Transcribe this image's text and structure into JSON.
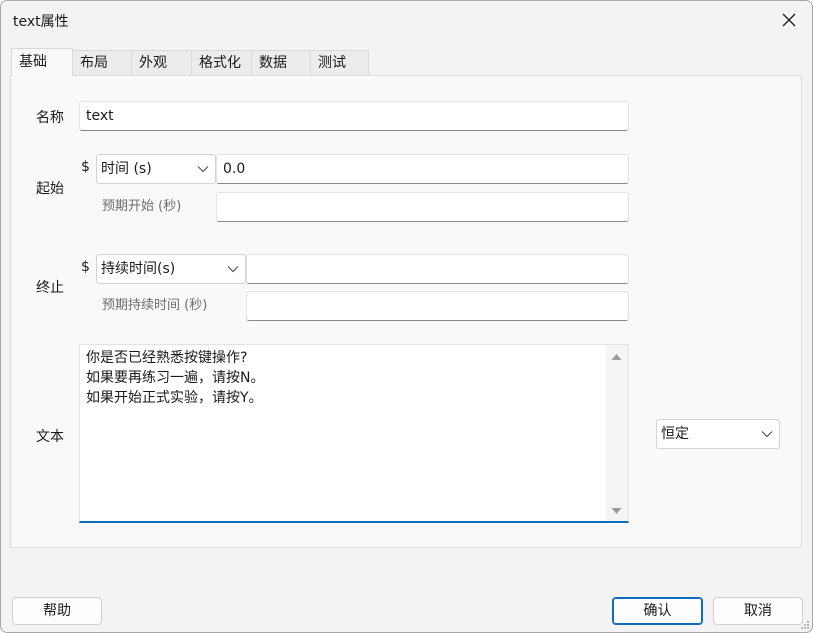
{
  "window": {
    "title": "text属性"
  },
  "tabs": [
    {
      "label": "基础"
    },
    {
      "label": "布局"
    },
    {
      "label": "外观"
    },
    {
      "label": "格式化"
    },
    {
      "label": "数据"
    },
    {
      "label": "测试"
    }
  ],
  "active_tab": "基础",
  "fields": {
    "name": {
      "label": "名称",
      "value": "text"
    },
    "start": {
      "label": "起始",
      "dollar": "$",
      "type_select": "时间 (s)",
      "value": "0.0",
      "expected_label": "预期开始 (秒)",
      "expected_value": ""
    },
    "stop": {
      "label": "终止",
      "dollar": "$",
      "type_select": "持续时间(s)",
      "value": "",
      "expected_label": "预期持续时间 (秒)",
      "expected_value": ""
    },
    "text": {
      "label": "文本",
      "lines": [
        "你是否已经熟悉按键操作?",
        "如果要再练习一遍，请按N。",
        "如果开始正式实验，请按Y。"
      ],
      "update_select": "恒定"
    }
  },
  "buttons": {
    "help": "帮助",
    "ok": "确认",
    "cancel": "取消"
  },
  "colors": {
    "accent": "#0f6cbd",
    "dialog_bg": "#f3f3f3",
    "panel_bg": "#f9f9f9"
  },
  "icons": [
    "close-icon",
    "chevron-down-icon",
    "scroll-up-arrow-icon",
    "scroll-down-arrow-icon",
    "resize-grip-icon"
  ]
}
